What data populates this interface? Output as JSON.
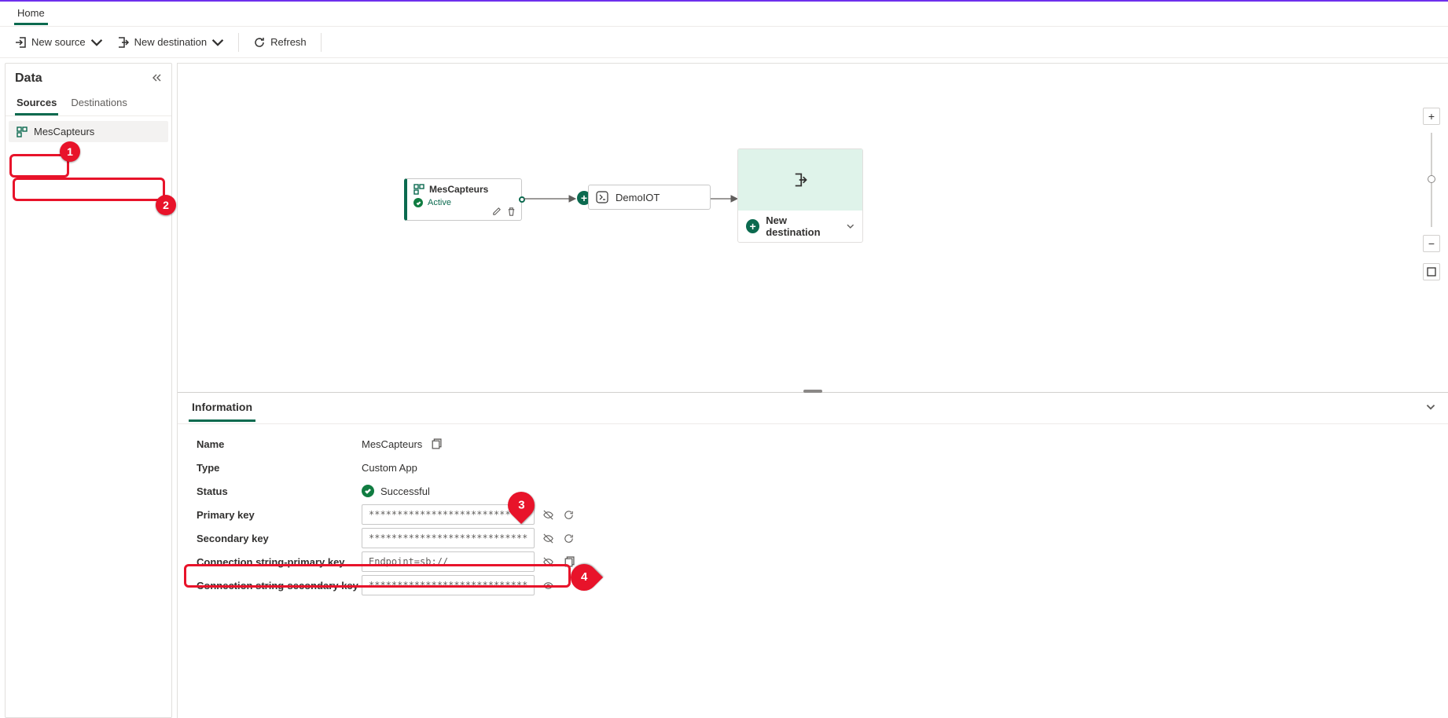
{
  "header": {
    "tab": "Home"
  },
  "toolbar": {
    "new_source": "New source",
    "new_destination": "New destination",
    "refresh": "Refresh"
  },
  "leftpanel": {
    "title": "Data",
    "tabs": {
      "sources": "Sources",
      "destinations": "Destinations"
    },
    "items": [
      {
        "label": "MesCapteurs"
      }
    ]
  },
  "canvas": {
    "source_node": {
      "title": "MesCapteurs",
      "status": "Active"
    },
    "mid_node": {
      "title": "DemoIOT"
    },
    "dest_node": {
      "new_label": "New destination"
    }
  },
  "info": {
    "tab": "Information",
    "rows": {
      "name": {
        "label": "Name",
        "value": "MesCapteurs"
      },
      "type": {
        "label": "Type",
        "value": "Custom App"
      },
      "status": {
        "label": "Status",
        "value": "Successful"
      },
      "primary_key": {
        "label": "Primary key",
        "value": "************************************"
      },
      "secondary_key": {
        "label": "Secondary key",
        "value": "************************************"
      },
      "conn_primary": {
        "label": "Connection string-primary key",
        "value": "Endpoint=sb://"
      },
      "conn_secondary": {
        "label": "Connection string-secondary key",
        "value": "************************************"
      }
    }
  },
  "annotations": {
    "n1": "1",
    "n2": "2",
    "n3": "3",
    "n4": "4"
  }
}
